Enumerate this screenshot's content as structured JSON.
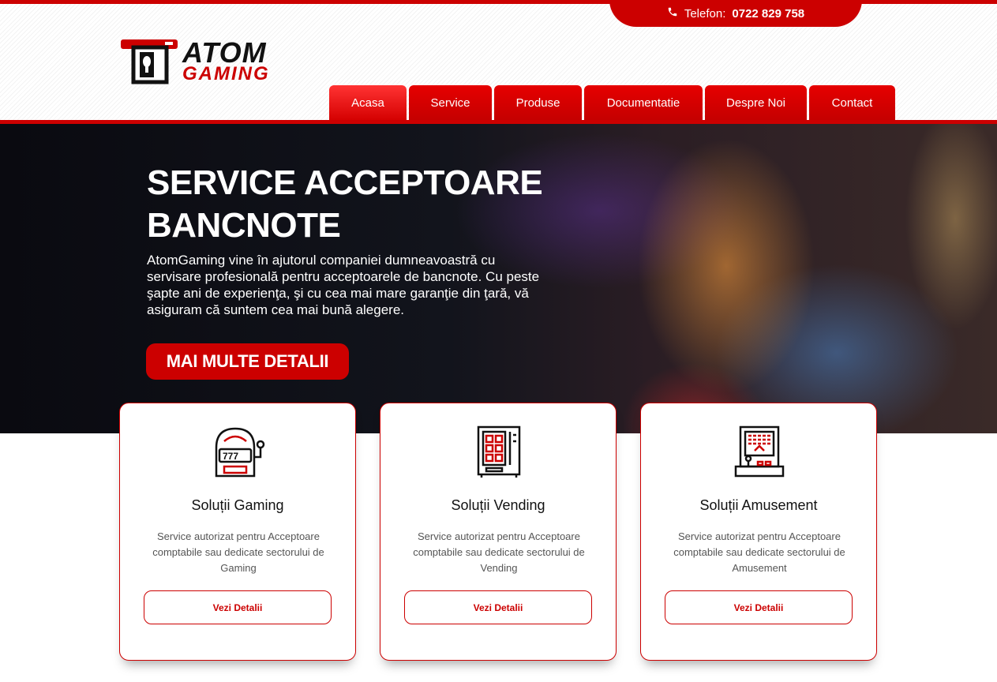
{
  "header": {
    "phone_label": "Telefon:",
    "phone_number": "0722 829 758",
    "logo_top": "ATOM",
    "logo_bottom": "GAMING"
  },
  "nav": {
    "items": [
      {
        "label": "Acasa",
        "active": true
      },
      {
        "label": "Service"
      },
      {
        "label": "Produse"
      },
      {
        "label": "Documentatie"
      },
      {
        "label": "Despre Noi"
      },
      {
        "label": "Contact"
      }
    ]
  },
  "hero": {
    "title_line1": "SERVICE ACCEPTOARE",
    "title_line2": "BANCNOTE",
    "text": "AtomGaming vine în ajutorul companiei dumneavoastră cu servisare profesională pentru acceptoarele de bancnote. Cu peste şapte ani de experienţa, şi cu cea mai mare garanţie din ţară, vă asiguram că suntem cea mai bună alegere.",
    "button": "MAI MULTE DETALII"
  },
  "cards": [
    {
      "title": "Soluții Gaming",
      "text": "Service autorizat pentru Acceptoare comptabile sau dedicate sectorului de Gaming",
      "button": "Vezi Detalii",
      "icon": "slot-machine-icon"
    },
    {
      "title": "Soluții Vending",
      "text": "Service autorizat pentru Acceptoare comptabile sau dedicate sectorului de Vending",
      "button": "Vezi Detalii",
      "icon": "vending-machine-icon"
    },
    {
      "title": "Soluții Amusement",
      "text": "Service autorizat pentru Acceptoare comptabile sau dedicate sectorului de Amusement",
      "button": "Vezi Detalii",
      "icon": "arcade-machine-icon"
    }
  ],
  "colors": {
    "accent": "#cc0000",
    "dark": "#111111"
  }
}
